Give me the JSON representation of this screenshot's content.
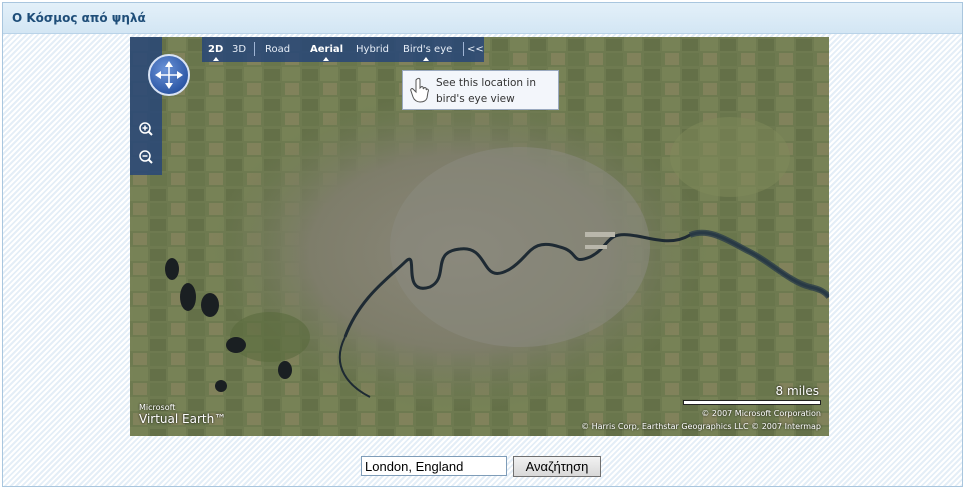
{
  "panel": {
    "title": "Ο Κόσμος από ψηλά"
  },
  "map": {
    "toolbar": {
      "view_2d": "2D",
      "view_3d": "3D",
      "road": "Road",
      "aerial": "Aerial",
      "hybrid": "Hybrid",
      "birds_eye": "Bird's eye",
      "collapse": "<<"
    },
    "tooltip": {
      "line1": "See this location in",
      "line2": "bird's eye view"
    },
    "scale": "8 miles",
    "copyright_line1": "© 2007 Microsoft Corporation",
    "copyright_line2": "© Harris Corp, Earthstar Geographics LLC   © 2007 Intermap",
    "logo_top": "Microsoft",
    "logo_main": "Virtual Earth™"
  },
  "search": {
    "value": "London, England",
    "button_label": "Αναζήτηση"
  },
  "colors": {
    "title": "#1f4e79",
    "panel_border": "#a9c6de",
    "river": "#1e2a33"
  }
}
